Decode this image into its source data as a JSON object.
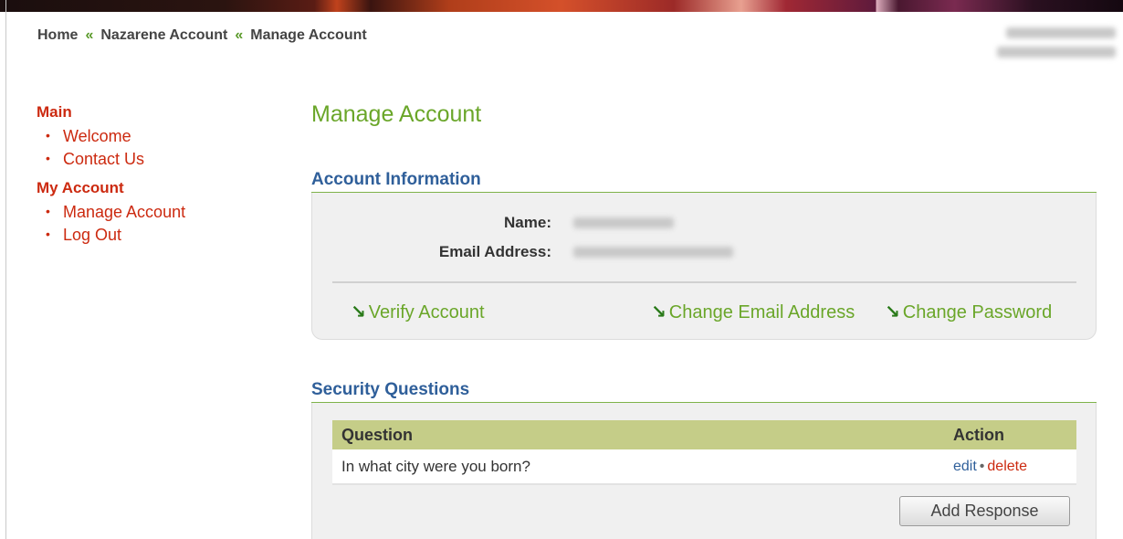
{
  "breadcrumb": {
    "items": [
      "Home",
      "Nazarene Account",
      "Manage Account"
    ],
    "separator": "«"
  },
  "sidebar": {
    "sections": [
      {
        "heading": "Main",
        "items": [
          "Welcome",
          "Contact Us"
        ]
      },
      {
        "heading": "My Account",
        "items": [
          "Manage Account",
          "Log Out"
        ]
      }
    ]
  },
  "main": {
    "page_title": "Manage Account",
    "account_info": {
      "title": "Account Information",
      "name_label": "Name:",
      "email_label": "Email Address:",
      "links": {
        "verify": "Verify Account",
        "change_email": "Change Email Address",
        "change_password": "Change Password"
      }
    },
    "security_questions": {
      "title": "Security Questions",
      "columns": [
        "Question",
        "Action"
      ],
      "rows": [
        {
          "question": "In what city were you born?",
          "edit": "edit",
          "separator": "•",
          "delete": "delete"
        }
      ],
      "add_button": "Add Response"
    }
  },
  "icons": {
    "link_arrow": "down-right-arrow-icon"
  },
  "colors": {
    "accent_green": "#6aa629",
    "heading_blue": "#2f5f9a",
    "nav_red": "#cc2a10",
    "table_header": "#c5cd88"
  }
}
